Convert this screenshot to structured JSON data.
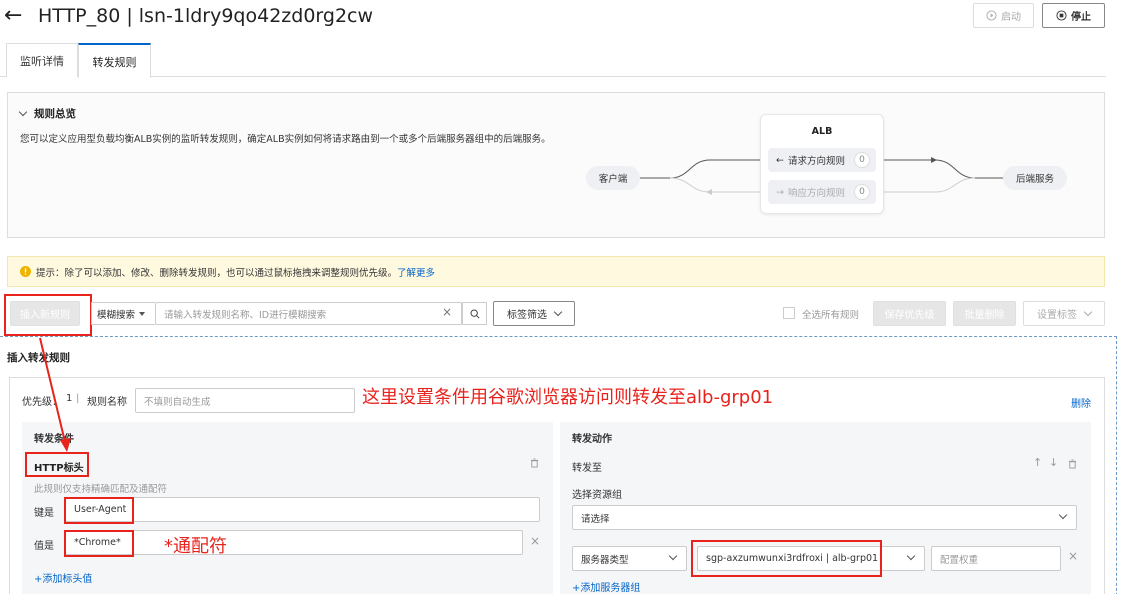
{
  "header": {
    "back_arrow": "←",
    "title": "HTTP_80 | lsn-1ldry9qo42zd0rg2cw",
    "start_label": "启动",
    "stop_label": "停止"
  },
  "tabs": [
    {
      "label": "监听详情",
      "active": false
    },
    {
      "label": "转发规则",
      "active": true
    }
  ],
  "overview": {
    "title": "规则总览",
    "description": "您可以定义应用型负载均衡ALB实例的监听转发规则，确定ALB实例如何将请求路由到一个或多个后端服务器组中的后端服务。",
    "client_label": "客户端",
    "alb_label": "ALB",
    "request_rule_label": "请求方向规则",
    "request_rule_count": "0",
    "response_rule_label": "响应方向规则",
    "response_rule_count": "0",
    "backend_label": "后端服务"
  },
  "notice": {
    "text": "提示：除了可以添加、修改、删除转发规则，也可以通过鼠标拖拽来调整规则优先级。",
    "link": "了解更多"
  },
  "toolbar": {
    "insert_rule": "插入新规则",
    "search_mode": "模糊搜索",
    "search_placeholder": "请输入转发规则名称、ID进行模糊搜索",
    "tag_filter": "标签筛选",
    "select_all": "全选所有规则",
    "save_priority": "保存优先级",
    "batch_delete": "批量删除",
    "set_tags": "设置标签"
  },
  "insert_panel": {
    "title": "插入转发规则",
    "priority_label": "优先级：",
    "priority_value": "1",
    "rule_name_label": "规则名称",
    "rule_name_placeholder": "不填则自动生成",
    "delete_label": "删除",
    "condition_title": "转发条件",
    "http_header_label": "HTTP标头",
    "header_hint": "此规则仅支持精确匹配及通配符",
    "key_label": "键是",
    "key_value": "User-Agent",
    "value_label": "值是",
    "value_value": "*Chrome*",
    "add_header_value": "+添加标头值",
    "action_title": "转发动作",
    "forward_to": "转发至",
    "select_resource_group": "选择资源组",
    "resource_group_placeholder": "请选择",
    "server_type": "服务器类型",
    "server_group_value": "sgp-axzumwunxi3rdfroxi | alb-grp01",
    "weight_placeholder": "配置权重",
    "add_server_group": "+添加服务器组"
  },
  "annotations": {
    "note_main": "这里设置条件用谷歌浏览器访问则转发至alb-grp01",
    "note_wildcard": "*通配符"
  },
  "colors": {
    "annotation_red": "#e8231c",
    "link_blue": "#0064c8",
    "notice_bg": "#fff9e0",
    "notice_icon": "#f0b400",
    "active_tab_border": "#0064c8"
  }
}
